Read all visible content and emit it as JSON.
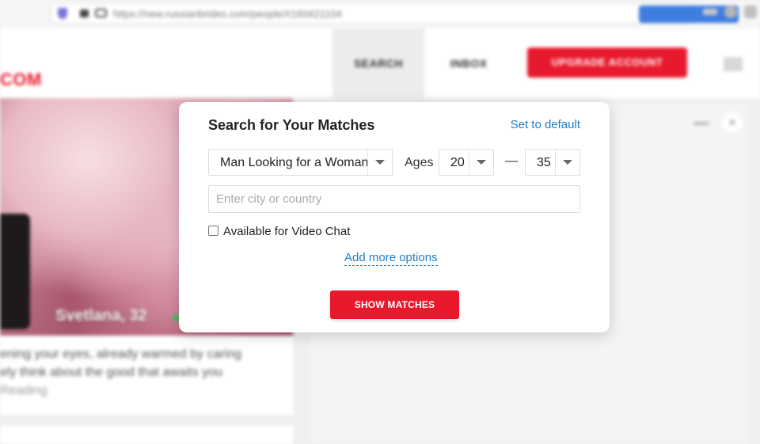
{
  "browser": {
    "url": "https://new.russianbrides.com/people/#160421104",
    "colors": {
      "shield": "#7b74d9",
      "action_button": "#3d7ee0"
    }
  },
  "site": {
    "logo_text": "COM",
    "nav": {
      "search": "SEARCH",
      "inbox": "INBOX"
    },
    "upgrade_label": "UPGRADE ACCOUNT",
    "colors": {
      "brand_red": "#e8192c",
      "link_blue": "#1f7ec8",
      "online": "#3ec15c"
    }
  },
  "profile_card": {
    "name": "Svetlana, 32",
    "text_lines": [
      "ening your eyes, already warmed by caring",
      "ely think about the good that awaits you"
    ],
    "read_more": "Reading"
  },
  "search_modal": {
    "title": "Search for Your Matches",
    "set_default": "Set to default",
    "seeking_value": "Man Looking for a Woman",
    "ages_label": "Ages",
    "age_from": "20",
    "age_separator": "—",
    "age_to": "35",
    "city_placeholder": "Enter city or country",
    "video_chat_label": "Available for Video Chat",
    "video_chat_checked": false,
    "add_more_options": "Add more options",
    "show_matches": "SHOW MATCHES"
  }
}
